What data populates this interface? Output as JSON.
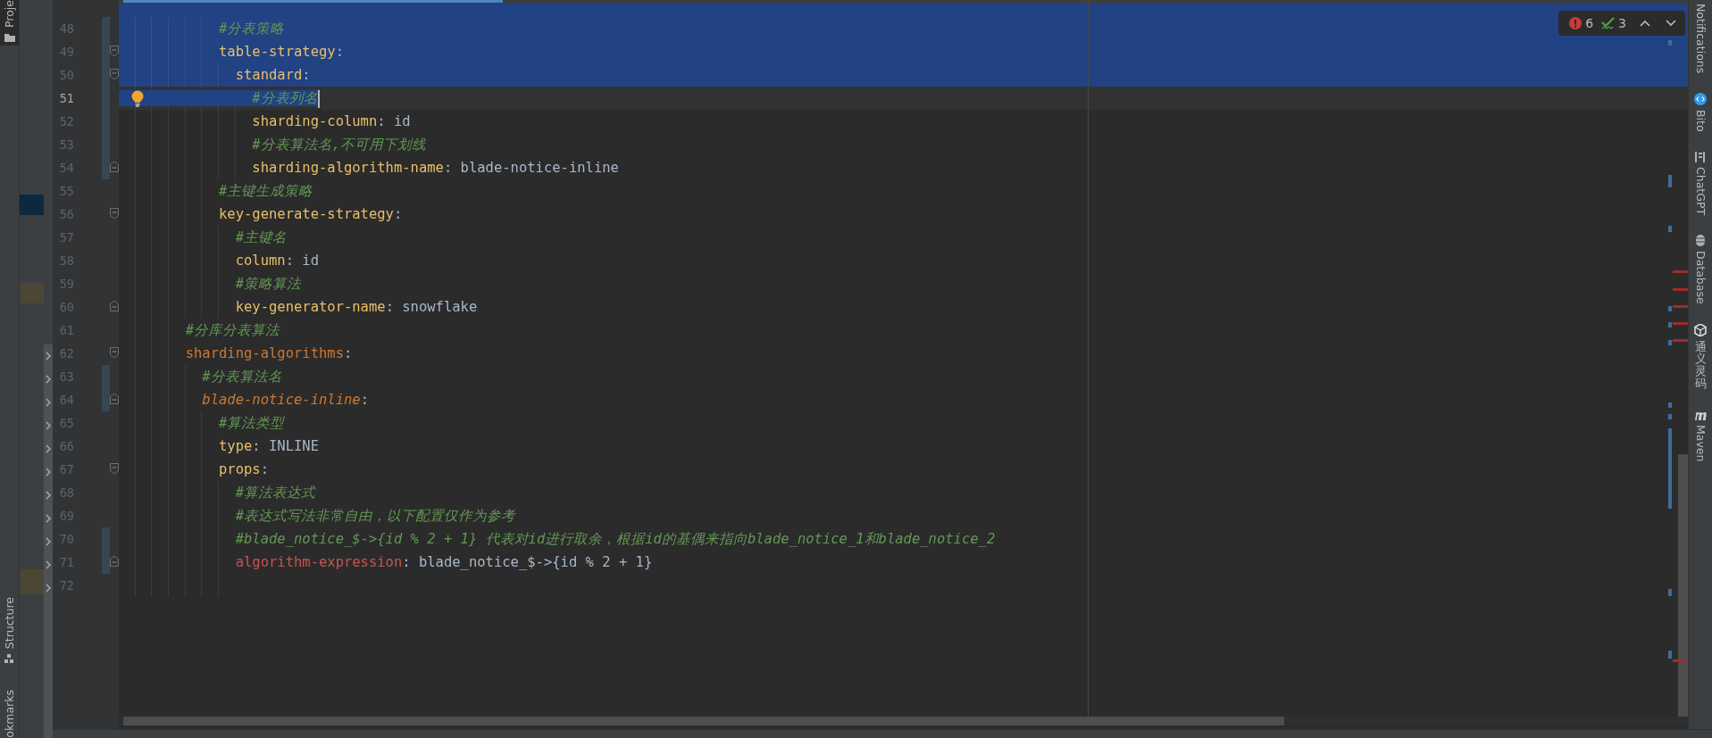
{
  "left_toolbar": {
    "top": [
      {
        "label": "Proje",
        "selected": true
      }
    ],
    "bottom": [
      {
        "label": "Structure",
        "selected": false
      },
      {
        "label": "okmarks",
        "selected": false
      }
    ]
  },
  "editor": {
    "inspections": {
      "errors": "6",
      "warnings": "3"
    },
    "lines": [
      {
        "number": "48",
        "tokens": [
          {
            "kind": "comment",
            "text": "            #分表策略"
          }
        ],
        "selected": true,
        "current": false,
        "changed": true,
        "fold_start": false,
        "fold_end": false,
        "bulb": false
      },
      {
        "number": "49",
        "tokens": [
          {
            "kind": "key",
            "text": "            table-strategy"
          },
          {
            "kind": "plain",
            "text": ":"
          }
        ],
        "selected": true,
        "current": false,
        "changed": true,
        "fold_start": true,
        "fold_end": false,
        "bulb": false
      },
      {
        "number": "50",
        "tokens": [
          {
            "kind": "key",
            "text": "              standard"
          },
          {
            "kind": "plain",
            "text": ":"
          }
        ],
        "selected": true,
        "current": false,
        "changed": true,
        "fold_start": true,
        "fold_end": false,
        "bulb": false
      },
      {
        "number": "51",
        "tokens": [
          {
            "kind": "comment",
            "text": "                #分表列名"
          }
        ],
        "selected": true,
        "current": true,
        "changed": true,
        "fold_start": false,
        "fold_end": false,
        "bulb": true
      },
      {
        "number": "52",
        "tokens": [
          {
            "kind": "key",
            "text": "                sharding-column"
          },
          {
            "kind": "plain",
            "text": ": id"
          }
        ],
        "selected": false,
        "current": false,
        "changed": true,
        "fold_start": false,
        "fold_end": false,
        "bulb": false
      },
      {
        "number": "53",
        "tokens": [
          {
            "kind": "comment",
            "text": "                #分表算法名,不可用下划线"
          }
        ],
        "selected": false,
        "current": false,
        "changed": true,
        "fold_start": false,
        "fold_end": false,
        "bulb": false
      },
      {
        "number": "54",
        "tokens": [
          {
            "kind": "key",
            "text": "                sharding-algorithm-name"
          },
          {
            "kind": "plain",
            "text": ": blade-notice-inline"
          }
        ],
        "selected": false,
        "current": false,
        "changed": true,
        "fold_start": false,
        "fold_end": true,
        "bulb": false
      },
      {
        "number": "55",
        "tokens": [
          {
            "kind": "comment",
            "text": "            #主键生成策略"
          }
        ],
        "selected": false,
        "current": false,
        "changed": false,
        "fold_start": false,
        "fold_end": false,
        "bulb": false
      },
      {
        "number": "56",
        "tokens": [
          {
            "kind": "key",
            "text": "            key-generate-strategy"
          },
          {
            "kind": "plain",
            "text": ":"
          }
        ],
        "selected": false,
        "current": false,
        "changed": false,
        "fold_start": true,
        "fold_end": false,
        "bulb": false
      },
      {
        "number": "57",
        "tokens": [
          {
            "kind": "comment",
            "text": "              #主键名"
          }
        ],
        "selected": false,
        "current": false,
        "changed": false,
        "fold_start": false,
        "fold_end": false,
        "bulb": false
      },
      {
        "number": "58",
        "tokens": [
          {
            "kind": "key",
            "text": "              column"
          },
          {
            "kind": "plain",
            "text": ": id"
          }
        ],
        "selected": false,
        "current": false,
        "changed": false,
        "fold_start": false,
        "fold_end": false,
        "bulb": false
      },
      {
        "number": "59",
        "tokens": [
          {
            "kind": "comment",
            "text": "              #策略算法"
          }
        ],
        "selected": false,
        "current": false,
        "changed": false,
        "fold_start": false,
        "fold_end": false,
        "bulb": false
      },
      {
        "number": "60",
        "tokens": [
          {
            "kind": "key",
            "text": "              key-generator-name"
          },
          {
            "kind": "plain",
            "text": ": snowflake"
          }
        ],
        "selected": false,
        "current": false,
        "changed": false,
        "fold_start": false,
        "fold_end": true,
        "bulb": false
      },
      {
        "number": "61",
        "tokens": [
          {
            "kind": "comment",
            "text": "        #分库分表算法"
          }
        ],
        "selected": false,
        "current": false,
        "changed": false,
        "fold_start": false,
        "fold_end": false,
        "bulb": false
      },
      {
        "number": "62",
        "tokens": [
          {
            "kind": "key-alt",
            "text": "        sharding-algorithms"
          },
          {
            "kind": "plain",
            "text": ":"
          }
        ],
        "selected": false,
        "current": false,
        "changed": false,
        "fold_start": true,
        "fold_end": false,
        "bulb": false
      },
      {
        "number": "63",
        "tokens": [
          {
            "kind": "comment",
            "text": "          #分表算法名"
          }
        ],
        "selected": false,
        "current": false,
        "changed": true,
        "fold_start": false,
        "fold_end": false,
        "bulb": false
      },
      {
        "number": "64",
        "tokens": [
          {
            "kind": "key-alt-italic",
            "text": "          blade-notice-inline"
          },
          {
            "kind": "plain",
            "text": ":"
          }
        ],
        "selected": false,
        "current": false,
        "changed": true,
        "fold_start": false,
        "fold_end": true,
        "bulb": false
      },
      {
        "number": "65",
        "tokens": [
          {
            "kind": "comment",
            "text": "            #算法类型"
          }
        ],
        "selected": false,
        "current": false,
        "changed": false,
        "fold_start": false,
        "fold_end": false,
        "bulb": false
      },
      {
        "number": "66",
        "tokens": [
          {
            "kind": "key",
            "text": "            type"
          },
          {
            "kind": "plain",
            "text": ": INLINE"
          }
        ],
        "selected": false,
        "current": false,
        "changed": false,
        "fold_start": false,
        "fold_end": false,
        "bulb": false
      },
      {
        "number": "67",
        "tokens": [
          {
            "kind": "key",
            "text": "            props"
          },
          {
            "kind": "plain",
            "text": ":"
          }
        ],
        "selected": false,
        "current": false,
        "changed": false,
        "fold_start": true,
        "fold_end": false,
        "bulb": false
      },
      {
        "number": "68",
        "tokens": [
          {
            "kind": "comment",
            "text": "              #算法表达式"
          }
        ],
        "selected": false,
        "current": false,
        "changed": false,
        "fold_start": false,
        "fold_end": false,
        "bulb": false
      },
      {
        "number": "69",
        "tokens": [
          {
            "kind": "comment",
            "text": "              #表达式写法非常自由，以下配置仅作为参考"
          }
        ],
        "selected": false,
        "current": false,
        "changed": false,
        "fold_start": false,
        "fold_end": false,
        "bulb": false
      },
      {
        "number": "70",
        "tokens": [
          {
            "kind": "comment",
            "text": "              #blade_notice_$->{id % 2 + 1} 代表对id进行取余，根据id的基偶来指向blade_notice_1和blade_notice_2"
          }
        ],
        "selected": false,
        "current": false,
        "changed": true,
        "fold_start": false,
        "fold_end": false,
        "bulb": false
      },
      {
        "number": "71",
        "tokens": [
          {
            "kind": "key-error",
            "text": "              algorithm-expression"
          },
          {
            "kind": "plain",
            "text": ": blade_notice_$->{id % 2 + 1}"
          }
        ],
        "selected": false,
        "current": false,
        "changed": true,
        "fold_start": false,
        "fold_end": true,
        "bulb": false
      },
      {
        "number": "72",
        "selected": false,
        "current": false,
        "changed": false,
        "fold_start": false,
        "fold_end": false,
        "bulb": false
      }
    ]
  },
  "right_toolbar": [
    {
      "label": "Notifications"
    },
    {
      "label": "Bito"
    },
    {
      "label": "ChatGPT"
    },
    {
      "label": "Database"
    },
    {
      "label": "通义灵码"
    },
    {
      "label": "Maven"
    }
  ]
}
